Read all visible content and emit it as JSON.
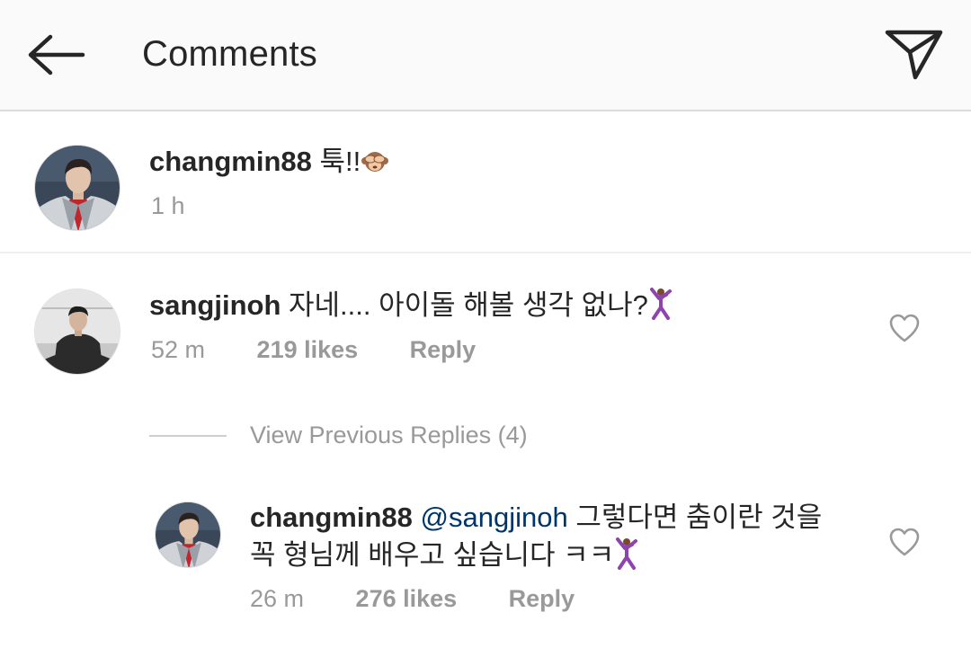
{
  "header": {
    "title": "Comments",
    "back_icon": "arrow-left-icon",
    "send_icon": "paper-plane-icon"
  },
  "caption": {
    "username": "changmin88",
    "text": "툭!!",
    "emoji": "see-no-evil-monkey-icon",
    "time": "1 h"
  },
  "comment": {
    "username": "sangjinoh",
    "text": "자네.... 아이돌 해볼 생각 없나?",
    "emoji": "dancer-icon",
    "time": "52 m",
    "likes": "219 likes",
    "reply_label": "Reply"
  },
  "view_previous": "View Previous Replies (4)",
  "reply": {
    "username": "changmin88",
    "mention": "@sangjinoh",
    "text_line1": "그렇다면 춤이란 것을",
    "text_line2": "꼭 형님께 배우고 싶습니다 ㅋㅋ",
    "emoji": "dancer-icon",
    "time": "26 m",
    "likes": "276 likes",
    "reply_label": "Reply"
  },
  "colors": {
    "header_bg": "#fafafa",
    "text": "#262626",
    "muted": "#999999",
    "mention": "#003569"
  }
}
